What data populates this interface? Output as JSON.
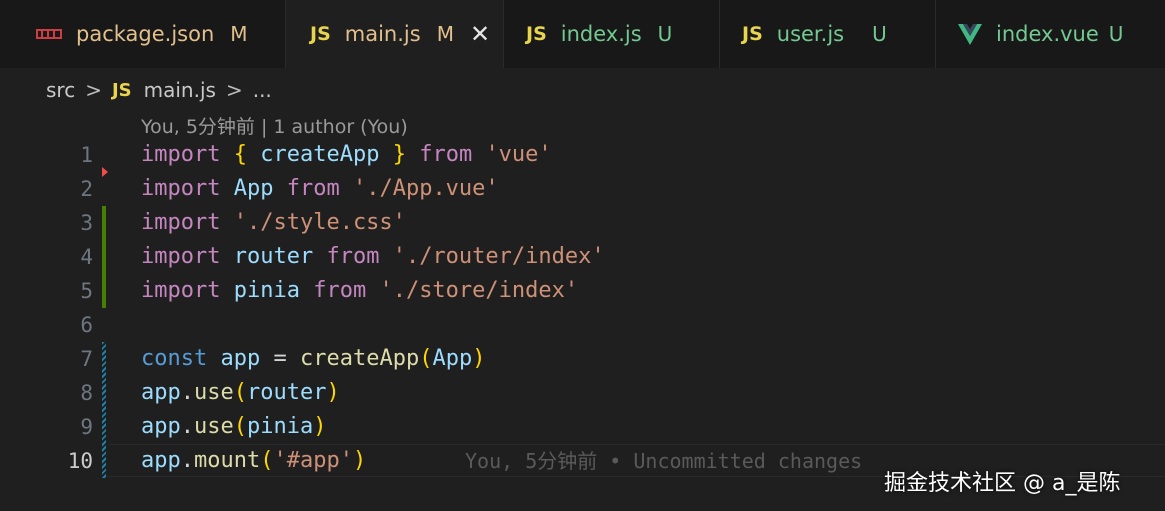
{
  "tabs": [
    {
      "icon": "json-icon",
      "name": "package.json",
      "status": "M",
      "name_color": "#e2c08d",
      "status_color": "#e2c08d"
    },
    {
      "icon": "js-icon",
      "icon_text": "JS",
      "name": "main.js",
      "status": "M",
      "close": "✕",
      "name_color": "#e2c08d",
      "status_color": "#e2c08d"
    },
    {
      "icon": "js-icon",
      "icon_text": "JS",
      "name": "index.js",
      "status": "U",
      "name_color": "#73c991",
      "status_color": "#73c991"
    },
    {
      "icon": "js-icon",
      "icon_text": "JS",
      "name": "user.js",
      "status": "U",
      "name_color": "#73c991",
      "status_color": "#73c991"
    },
    {
      "icon": "vue-icon",
      "name": "index.vue",
      "status": "U",
      "name_color": "#73c991",
      "status_color": "#73c991"
    }
  ],
  "breadcrumb": {
    "folder": "src",
    "sep": ">",
    "file_icon": "JS",
    "file": "main.js",
    "more": "..."
  },
  "codelens": "You, 5分钟前 | 1 author (You)",
  "lines": [
    {
      "n": "1",
      "tokens": [
        [
          "kw2",
          "import"
        ],
        [
          "txt",
          " "
        ],
        [
          "brace",
          "{"
        ],
        [
          "txt",
          " "
        ],
        [
          "var",
          "createApp"
        ],
        [
          "txt",
          " "
        ],
        [
          "brace",
          "}"
        ],
        [
          "txt",
          " "
        ],
        [
          "kw2",
          "from"
        ],
        [
          "txt",
          " "
        ],
        [
          "str",
          "'vue'"
        ]
      ]
    },
    {
      "n": "2",
      "tokens": [
        [
          "kw2",
          "import"
        ],
        [
          "txt",
          " "
        ],
        [
          "var",
          "App"
        ],
        [
          "txt",
          " "
        ],
        [
          "kw2",
          "from"
        ],
        [
          "txt",
          " "
        ],
        [
          "str",
          "'./App.vue'"
        ]
      ]
    },
    {
      "n": "3",
      "tokens": [
        [
          "kw2",
          "import"
        ],
        [
          "txt",
          " "
        ],
        [
          "str",
          "'./style.css'"
        ]
      ]
    },
    {
      "n": "4",
      "tokens": [
        [
          "kw2",
          "import"
        ],
        [
          "txt",
          " "
        ],
        [
          "var",
          "router"
        ],
        [
          "txt",
          " "
        ],
        [
          "kw2",
          "from"
        ],
        [
          "txt",
          " "
        ],
        [
          "str",
          "'./router/index'"
        ]
      ]
    },
    {
      "n": "5",
      "tokens": [
        [
          "kw2",
          "import"
        ],
        [
          "txt",
          " "
        ],
        [
          "var",
          "pinia"
        ],
        [
          "txt",
          " "
        ],
        [
          "kw2",
          "from"
        ],
        [
          "txt",
          " "
        ],
        [
          "str",
          "'./store/index'"
        ]
      ]
    },
    {
      "n": "6",
      "tokens": []
    },
    {
      "n": "7",
      "tokens": [
        [
          "kw",
          "const"
        ],
        [
          "txt",
          " "
        ],
        [
          "var",
          "app"
        ],
        [
          "txt",
          " = "
        ],
        [
          "fn",
          "createApp"
        ],
        [
          "paren",
          "("
        ],
        [
          "var",
          "App"
        ],
        [
          "paren",
          ")"
        ]
      ]
    },
    {
      "n": "8",
      "tokens": [
        [
          "var",
          "app"
        ],
        [
          "txt",
          "."
        ],
        [
          "fn",
          "use"
        ],
        [
          "paren",
          "("
        ],
        [
          "var",
          "router"
        ],
        [
          "paren",
          ")"
        ]
      ]
    },
    {
      "n": "9",
      "tokens": [
        [
          "var",
          "app"
        ],
        [
          "txt",
          "."
        ],
        [
          "fn",
          "use"
        ],
        [
          "paren",
          "("
        ],
        [
          "var",
          "pinia"
        ],
        [
          "paren",
          ")"
        ]
      ]
    },
    {
      "n": "10",
      "tokens": [
        [
          "var",
          "app"
        ],
        [
          "txt",
          "."
        ],
        [
          "fn",
          "mount"
        ],
        [
          "paren",
          "("
        ],
        [
          "str",
          "'#app'"
        ],
        [
          "paren",
          ")"
        ]
      ],
      "current": true
    }
  ],
  "blame": "You, 5分钟前 • Uncommitted changes",
  "watermark": "掘金技术社区 @ a_是陈",
  "colors": {
    "keyword_control": "#c586c0",
    "keyword": "#569cd6",
    "string": "#ce9178",
    "function": "#dcdcaa",
    "variable": "#9cdcfe",
    "bracket": "#ffd700",
    "gutter_added": "#487e02",
    "gutter_modified": "#1b81a8",
    "gutter_deleted": "#f14c4c"
  }
}
